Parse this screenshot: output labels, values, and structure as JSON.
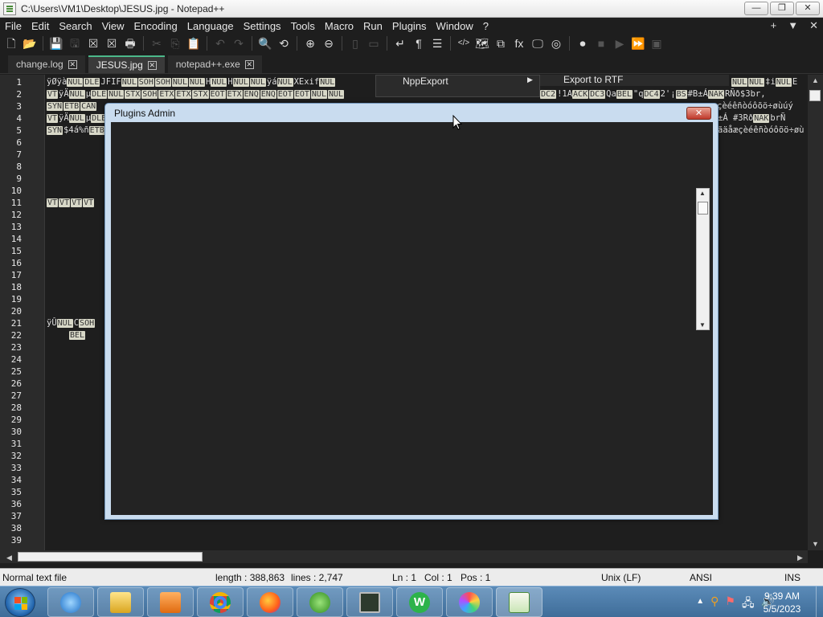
{
  "window": {
    "title": "C:\\Users\\VM1\\Desktop\\JESUS.jpg - Notepad++",
    "controls": [
      "—",
      "❐",
      "✕"
    ]
  },
  "menubar": {
    "items": [
      "File",
      "Edit",
      "Search",
      "View",
      "Encoding",
      "Language",
      "Settings",
      "Tools",
      "Macro",
      "Run",
      "Plugins",
      "Window",
      "?"
    ],
    "right": [
      "+",
      "▼",
      "✕"
    ]
  },
  "toolbar": {
    "icons": [
      {
        "name": "new-file-icon",
        "glyph": "🗋"
      },
      {
        "name": "open-file-icon",
        "glyph": "📂"
      },
      {
        "name": "save-icon",
        "glyph": "💾",
        "dim": true
      },
      {
        "name": "save-all-icon",
        "glyph": "🖫",
        "dim": true
      },
      {
        "name": "close-icon",
        "glyph": "☒"
      },
      {
        "name": "close-all-icon",
        "glyph": "☒"
      },
      {
        "name": "print-icon",
        "glyph": "🖶"
      },
      {
        "name": "cut-icon",
        "glyph": "✂",
        "dim": true
      },
      {
        "name": "copy-icon",
        "glyph": "⎘",
        "dim": true
      },
      {
        "name": "paste-icon",
        "glyph": "📋",
        "dim": true
      },
      {
        "name": "undo-icon",
        "glyph": "↶",
        "dim": true
      },
      {
        "name": "redo-icon",
        "glyph": "↷",
        "dim": true
      },
      {
        "name": "find-icon",
        "glyph": "🔍"
      },
      {
        "name": "replace-icon",
        "glyph": "⟲"
      },
      {
        "name": "zoom-in-icon",
        "glyph": "⊕"
      },
      {
        "name": "zoom-out-icon",
        "glyph": "⊖"
      },
      {
        "name": "sync-v-icon",
        "glyph": "▯",
        "dim": true
      },
      {
        "name": "sync-h-icon",
        "glyph": "▭",
        "dim": true
      },
      {
        "name": "word-wrap-icon",
        "glyph": "↵"
      },
      {
        "name": "show-all-chars-icon",
        "glyph": "¶"
      },
      {
        "name": "indent-guide-icon",
        "glyph": "☰"
      },
      {
        "name": "xml-icon",
        "glyph": "</>"
      },
      {
        "name": "doc-map-icon",
        "glyph": "🗺"
      },
      {
        "name": "doc-list-icon",
        "glyph": "⧉"
      },
      {
        "name": "function-list-icon",
        "glyph": "fx"
      },
      {
        "name": "folder-workspace-icon",
        "glyph": "🖵"
      },
      {
        "name": "monitor-icon",
        "glyph": "◎"
      },
      {
        "name": "record-macro-icon",
        "glyph": "⏺"
      },
      {
        "name": "stop-macro-icon",
        "glyph": "■",
        "dim": true
      },
      {
        "name": "play-macro-icon",
        "glyph": "▶",
        "dim": true
      },
      {
        "name": "run-macro-multiple-icon",
        "glyph": "⏩"
      },
      {
        "name": "save-macro-icon",
        "glyph": "▣",
        "dim": true
      }
    ]
  },
  "tabs": [
    {
      "label": "change.log",
      "active": false
    },
    {
      "label": "JESUS.jpg",
      "active": true
    },
    {
      "label": "notepad++.exe",
      "active": false
    }
  ],
  "editor": {
    "line_numbers": [
      "1",
      "2",
      "3",
      "4",
      "5",
      "6",
      "7",
      "8",
      "9",
      "10",
      "11",
      "12",
      "13",
      "14",
      "15",
      "16",
      "17",
      "18",
      "19",
      "20",
      "21",
      "22",
      "23",
      "24",
      "25",
      "26",
      "27",
      "28",
      "29",
      "30",
      "31",
      "32",
      "33",
      "34",
      "35",
      "36",
      "37",
      "38",
      "39"
    ],
    "line1": [
      "ÿØÿà",
      "[NUL]",
      "[DLE]",
      "JFIF",
      "[NUL]",
      "[SOH]",
      "[SOH]",
      "[NUL]",
      "[NUL]",
      "H",
      "[NUL]",
      "H",
      "[NUL]",
      "[NUL]",
      "ÿá",
      "[NUL]",
      "XExif",
      "[NUL]"
    ],
    "line1_right": [
      "[NUL]",
      "[NUL]",
      "‡i",
      "[NUL]",
      "E"
    ],
    "line2": [
      "[VT]",
      "ÿÄ",
      "[NUL]",
      "µ",
      "[DLE]",
      "[NUL]",
      "[STX]",
      "[SOH]",
      "[ETX]",
      "[ETX]",
      "[STX]",
      "[EOT]",
      "[ETX]",
      "[ENQ]",
      "[ENQ]",
      "[EOT]",
      "[EOT]",
      "[NUL]",
      "[NUL]"
    ],
    "line2_right": [
      "[DC2]",
      "!1A",
      "[ACK]",
      "[DC3]",
      "Qa",
      "[BEL]",
      "\"q",
      "[DC4]",
      "2'¡",
      "[BS]",
      "#B±Á",
      "[NAK]",
      "RÑð$3br,"
    ],
    "line3": [
      "[SYN]",
      "[ETB]",
      "[CAN]"
    ],
    "line3_right": [
      "çèéêñòóôõö÷øùúý"
    ],
    "line4": [
      "[VT]",
      "ÿÄ",
      "[NUL]",
      "µ",
      "[DLE]"
    ],
    "line4_right": [
      "±Á",
      "   #3Rð",
      "[NAK]",
      "brÑ"
    ],
    "line5": [
      "[SYN]",
      "$4á%ñ",
      "[ETB]"
    ],
    "line5_right": [
      "ãäåæçèéêñòóôõö÷øù"
    ],
    "line11": [
      "[VT]",
      "[VT]",
      "[VT]",
      "[VT]"
    ],
    "line21": [
      "ÿÛ",
      "[NUL]",
      "C",
      "[SOH]"
    ],
    "line22": [
      "[BEL]"
    ]
  },
  "plugins_menu": {
    "item": "NppExport",
    "submenu_item": "Export to RTF"
  },
  "dialog": {
    "title": "Plugins Admin",
    "close": "✕"
  },
  "statusbar": {
    "file_type": "Normal text file",
    "length": "length : 388,863",
    "lines": "lines : 2,747",
    "ln": "Ln : 1",
    "col": "Col : 1",
    "pos": "Pos : 1",
    "eol": "Unix (LF)",
    "encoding": "ANSI",
    "mode": "INS"
  },
  "taskbar": {
    "apps": [
      "internet-explorer",
      "file-explorer",
      "media-player",
      "chrome",
      "firefox",
      "windows-media-center",
      "task-manager",
      "word-processor",
      "colorful-app",
      "notepad-plus-plus"
    ],
    "clock_time": "9:39 AM",
    "clock_date": "5/5/2023"
  },
  "colors": {
    "accent_tab": "#4cb88a",
    "dialog_frame": "#c9dcef",
    "taskbar": "#4a7aa8"
  }
}
